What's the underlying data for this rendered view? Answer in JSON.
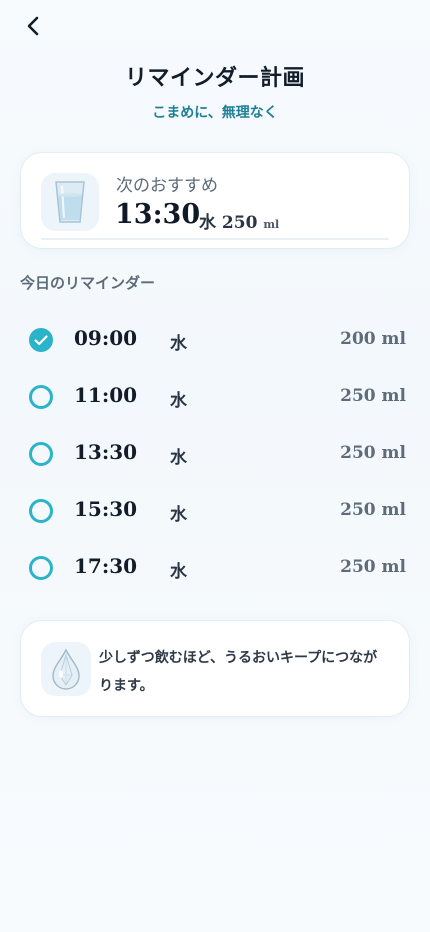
{
  "header": {
    "title": "リマインダー計画",
    "subtitle": "こまめに、無理なく"
  },
  "next": {
    "label": "次のおすすめ",
    "time": "13:30",
    "drink": "水",
    "amount": "250",
    "unit": "ml"
  },
  "today": {
    "title": "今日のリマインダー",
    "items": [
      {
        "time": "09:00",
        "drink": "水",
        "amount": "200 ml",
        "status": "done"
      },
      {
        "time": "11:00",
        "drink": "水",
        "amount": "250 ml",
        "status": "pending"
      },
      {
        "time": "13:30",
        "drink": "水",
        "amount": "250 ml",
        "status": "pending"
      },
      {
        "time": "15:30",
        "drink": "水",
        "amount": "250 ml",
        "status": "pending"
      },
      {
        "time": "17:30",
        "drink": "水",
        "amount": "250 ml",
        "status": "pending"
      }
    ]
  },
  "tip": {
    "text": "少しずつ飲むほど、うるおいキープにつながります。"
  },
  "icons": {
    "back": "chevron-left-icon",
    "glass": "water-glass-icon",
    "done": "check-circle-icon",
    "pending": "empty-circle-icon",
    "drop": "water-drop-icon"
  },
  "colors": {
    "accent": "#2bb3c9",
    "subtitle": "#1d7f96",
    "title": "#121c2a",
    "muted": "#5e6b78"
  }
}
